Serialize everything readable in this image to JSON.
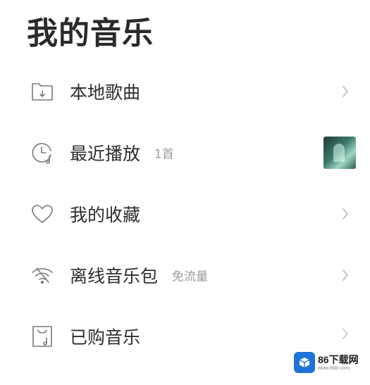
{
  "header": {
    "title": "我的音乐"
  },
  "menu": {
    "items": [
      {
        "label": "本地歌曲",
        "badge": "",
        "icon": "folder-download-icon",
        "trailing": "chevron-right-icon"
      },
      {
        "label": "最近播放",
        "badge": "1首",
        "icon": "clock-music-icon",
        "trailing": "album-thumbnail"
      },
      {
        "label": "我的收藏",
        "badge": "",
        "icon": "heart-icon",
        "trailing": "chevron-right-icon"
      },
      {
        "label": "离线音乐包",
        "badge": "免流量",
        "icon": "wifi-icon",
        "trailing": "chevron-right-icon"
      },
      {
        "label": "已购音乐",
        "badge": "",
        "icon": "shopping-bag-music-icon",
        "trailing": "chevron-right-icon"
      }
    ]
  },
  "watermark": {
    "name": "86下载网",
    "site": "www.86kr.com"
  },
  "colors": {
    "text": "#2d2d2d",
    "muted": "#9a9a9a",
    "icon_stroke": "#7a7a7a",
    "watermark_blue": "#1e73d6"
  }
}
